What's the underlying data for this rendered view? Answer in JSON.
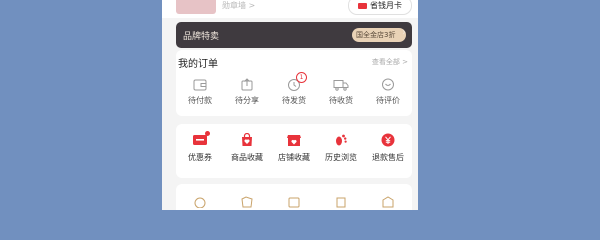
{
  "header": {
    "badge_wall": "勋章墙 >",
    "month_card": {
      "label": "省钱月卡",
      "icon": "card-icon"
    }
  },
  "brand": {
    "title": "品牌特卖",
    "pill": "国全金店3折",
    "arrow": "›"
  },
  "orders": {
    "title": "我的订单",
    "view_all": "查看全部 >",
    "items": [
      {
        "label": "待付款",
        "icon": "wallet-icon"
      },
      {
        "label": "待分享",
        "icon": "share-icon"
      },
      {
        "label": "待发货",
        "icon": "clock-icon",
        "badge": "1"
      },
      {
        "label": "待收货",
        "icon": "truck-icon"
      },
      {
        "label": "待评价",
        "icon": "comment-icon"
      }
    ]
  },
  "favorites": {
    "items": [
      {
        "label": "优惠券",
        "icon": "coupon-icon"
      },
      {
        "label": "商品收藏",
        "icon": "bag-heart-icon"
      },
      {
        "label": "店铺收藏",
        "icon": "store-heart-icon"
      },
      {
        "label": "历史浏览",
        "icon": "footprint-icon"
      },
      {
        "label": "退款售后",
        "icon": "refund-icon"
      }
    ]
  },
  "colors": {
    "background": "#7190bf",
    "accent": "#e8333b",
    "banner": "#3f3a3f",
    "banner_pill": "#e9d2b6"
  }
}
